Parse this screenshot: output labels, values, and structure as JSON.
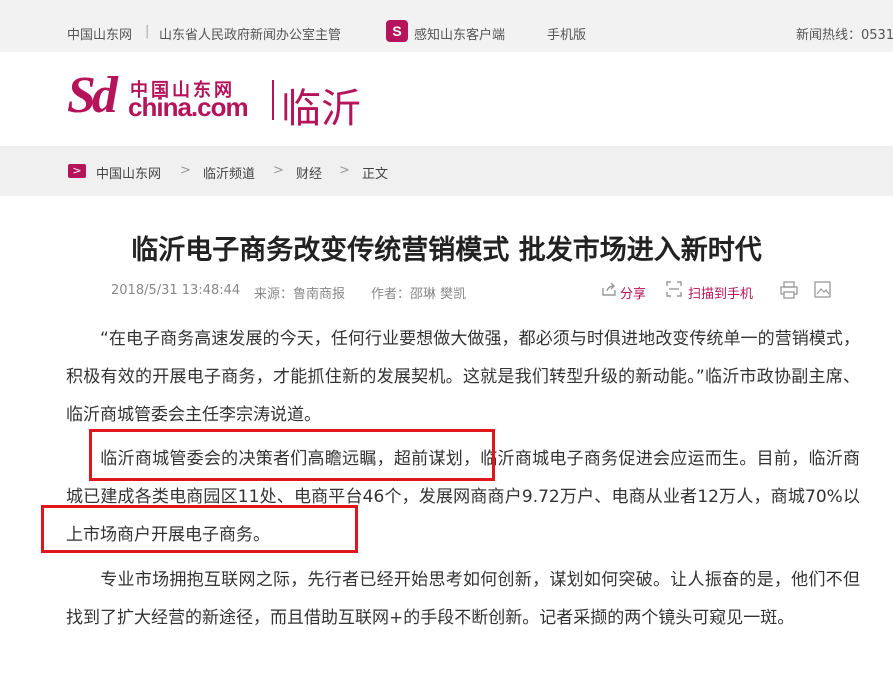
{
  "topbar": {
    "site": "中国山东网",
    "divider": "|",
    "host": "山东省人民政府新闻办公室主管",
    "app_icon": "S",
    "app_label": "感知山东客户端",
    "mobile": "手机版",
    "hotline": "新闻热线：0531"
  },
  "logo": {
    "mark": "Sd",
    "chinese": "中国山东网",
    "domain": "china.com",
    "city": "临沂"
  },
  "breadcrumb": {
    "icon": ">",
    "items": [
      "中国山东网",
      "临沂频道",
      "财经",
      "正文"
    ],
    "separator": ">"
  },
  "article": {
    "title": "临沂电子商务改变传统营销模式 批发市场进入新时代",
    "datetime": "2018/5/31 13:48:44",
    "source": "来源：鲁南商报",
    "author": "作者：邵琳 樊凯",
    "share": "分享",
    "scan": "扫描到手机",
    "para1": "“在电子商务高速发展的今天，任何行业要想做大做强，都必须与时俱进地改变传统单一的营销模式，积极有效的开展电子商务，才能抓住新的发展契机。这就是我们转型升级的新动能。”临沂市政协副主席、临沂商城管委会主任李宗涛说道。",
    "para2": "临沂商城管委会的决策者们高瞻远瞩，超前谋划，临沂商城电子商务促进会应运而生。目前，临沂商城已建成各类电商园区11处、电商平台46个，发展网商商户9.72万户、电商从业者12万人，商城70%以上市场商户开展电子商务。",
    "para3": "专业市场拥抱互联网之际，先行者已经开始思考如何创新，谋划如何突破。让人振奋的是，他们不但找到了扩大经营的新途径，而且借助互联网+的手段不断创新。记者采撷的两个镜头可窥见一斑。"
  },
  "colors": {
    "brand": "#b5145b",
    "highlight": "#e0161e"
  },
  "icons": [
    "app-logo-icon",
    "breadcrumb-arrow-icon",
    "share-icon",
    "qr-scan-icon",
    "print-icon",
    "image-icon"
  ]
}
